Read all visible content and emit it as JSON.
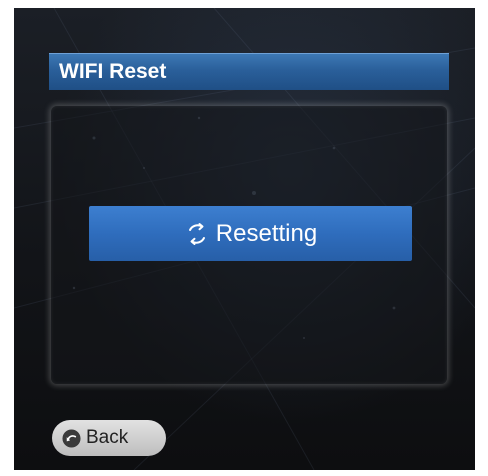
{
  "header": {
    "title": "WIFI Reset"
  },
  "main": {
    "reset_button_label": "Resetting",
    "reset_icon": "refresh-icon"
  },
  "footer": {
    "back_label": "Back",
    "back_icon": "back-arrow-icon"
  },
  "colors": {
    "title_bar": "#2a5f9a",
    "button_blue": "#2f6dbd",
    "background": "#121418",
    "back_button": "#cfcfcf"
  }
}
